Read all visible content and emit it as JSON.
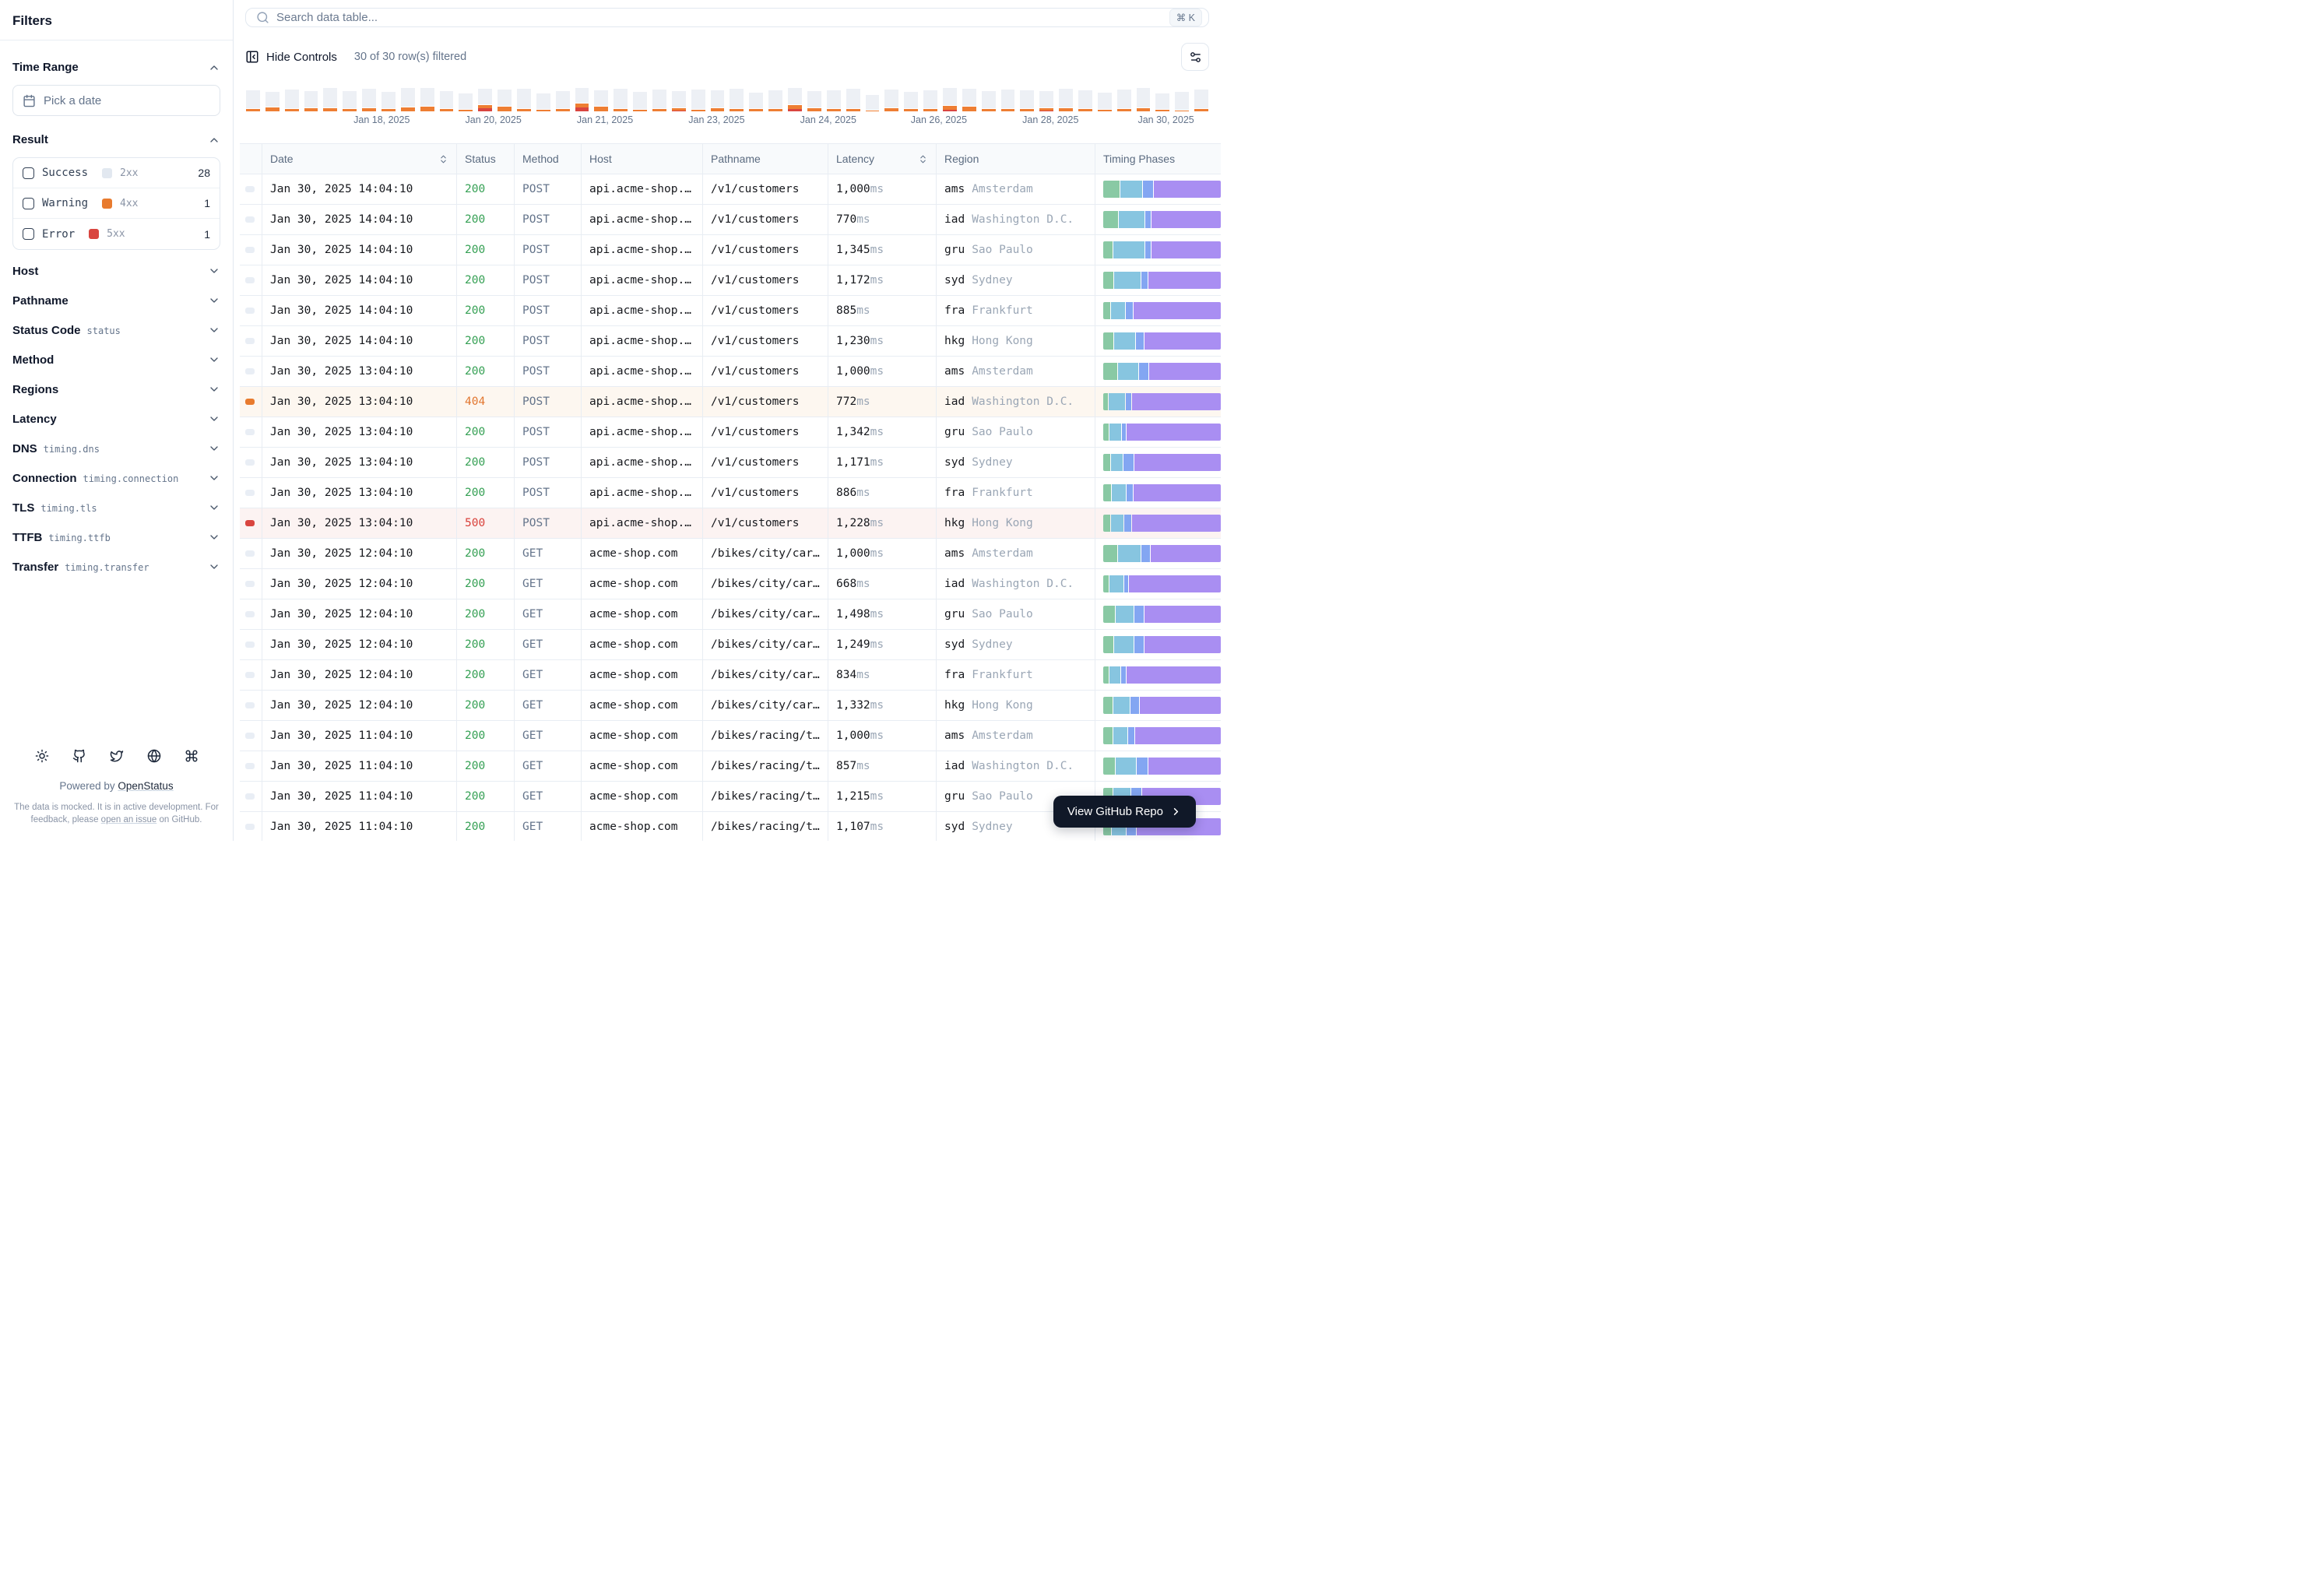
{
  "sidebar": {
    "title": "Filters",
    "time_range": {
      "label": "Time Range",
      "placeholder": "Pick a date"
    },
    "result": {
      "label": "Result",
      "items": [
        {
          "label": "Success",
          "code": "2xx",
          "count": "28",
          "swatch": "#e2e8f0"
        },
        {
          "label": "Warning",
          "code": "4xx",
          "count": "1",
          "swatch": "#e87b2e"
        },
        {
          "label": "Error",
          "code": "5xx",
          "count": "1",
          "swatch": "#d9453f"
        }
      ]
    },
    "sections": [
      {
        "label": "Host"
      },
      {
        "label": "Pathname"
      },
      {
        "label": "Status Code",
        "code": "status"
      },
      {
        "label": "Method"
      },
      {
        "label": "Regions"
      },
      {
        "label": "Latency"
      },
      {
        "label": "DNS",
        "code": "timing.dns"
      },
      {
        "label": "Connection",
        "code": "timing.connection"
      },
      {
        "label": "TLS",
        "code": "timing.tls"
      },
      {
        "label": "TTFB",
        "code": "timing.ttfb"
      },
      {
        "label": "Transfer",
        "code": "timing.transfer"
      }
    ],
    "footer": {
      "icons": [
        "sun-icon",
        "github-icon",
        "twitter-icon",
        "globe-icon",
        "command-icon"
      ],
      "powered_prefix": "Powered by ",
      "brand": "OpenStatus",
      "note_pre": "The data is mocked. It is in active development. For feedback, please ",
      "note_link": "open an issue",
      "note_post": " on GitHub."
    }
  },
  "topbar": {
    "search_placeholder": "Search data table...",
    "shortcut": "⌘ K"
  },
  "controls": {
    "hide_label": "Hide Controls",
    "filtered_text": "30 of 30 row(s) filtered"
  },
  "chart_data": {
    "type": "bar",
    "stacked": true,
    "x_labels": [
      "Jan 18, 2025",
      "Jan 20, 2025",
      "Jan 21, 2025",
      "Jan 23, 2025",
      "Jan 24, 2025",
      "Jan 26, 2025",
      "Jan 28, 2025",
      "Jan 30, 2025"
    ],
    "label_positions_pct": [
      14.1,
      25.7,
      37.3,
      48.9,
      60.5,
      72.0,
      83.6,
      95.6
    ],
    "ylabel": "",
    "xlabel": "",
    "legend": "none",
    "series": [
      {
        "name": "success-2xx",
        "color": "#edf0f5",
        "values": [
          23,
          19,
          24,
          21,
          25,
          22,
          24,
          21,
          24,
          23,
          22,
          20,
          20,
          21,
          25,
          20,
          22,
          19,
          20,
          25,
          22,
          24,
          21,
          25,
          22,
          25,
          20,
          23,
          21,
          21,
          23,
          25,
          19,
          23,
          21,
          23,
          22,
          22,
          22,
          24,
          23,
          21,
          24,
          23,
          21,
          24,
          25,
          20,
          23,
          24
        ]
      },
      {
        "name": "warning-4xx",
        "color": "#ee7e33",
        "values": [
          3,
          5,
          3,
          4,
          4,
          3,
          4,
          3,
          5,
          6,
          3,
          2,
          4,
          6,
          3,
          2,
          3,
          5,
          6,
          3,
          2,
          3,
          3,
          2,
          4,
          3,
          3,
          3,
          5,
          4,
          3,
          3,
          1,
          4,
          3,
          3,
          5,
          6,
          3,
          3,
          3,
          3,
          4,
          3,
          2,
          3,
          4,
          2,
          1,
          3
        ]
      },
      {
        "name": "error-5xx",
        "color": "#d9453f",
        "values": [
          0,
          0,
          0,
          0,
          0,
          0,
          0,
          0,
          0,
          0,
          0,
          0,
          4,
          0,
          0,
          0,
          0,
          5,
          0,
          0,
          0,
          0,
          1,
          0,
          0,
          0,
          0,
          0,
          3,
          0,
          0,
          0,
          0,
          0,
          0,
          0,
          2,
          0,
          0,
          0,
          0,
          1,
          0,
          0,
          0,
          0,
          0,
          0,
          0,
          0
        ]
      }
    ]
  },
  "table": {
    "timing_colors": [
      "#89c9a4",
      "#87c5e0",
      "#83a6f2",
      "#a98ef2"
    ],
    "columns": [
      {
        "label": "Date",
        "sortable": true
      },
      {
        "label": "Status",
        "sortable": false
      },
      {
        "label": "Method",
        "sortable": false
      },
      {
        "label": "Host",
        "sortable": false
      },
      {
        "label": "Pathname",
        "sortable": false
      },
      {
        "label": "Latency",
        "sortable": true
      },
      {
        "label": "Region",
        "sortable": false
      },
      {
        "label": "Timing Phases",
        "sortable": false
      }
    ],
    "rows": [
      {
        "date": "Jan 30, 2025 14:04:10",
        "status": "200",
        "level": "success",
        "method": "POST",
        "host": "api.acme-shop.…",
        "path": "/v1/customers",
        "latency": "1,000",
        "unit": "ms",
        "region": "ams",
        "city": "Amsterdam",
        "timing": [
          14,
          19,
          9,
          58
        ]
      },
      {
        "date": "Jan 30, 2025 14:04:10",
        "status": "200",
        "level": "success",
        "method": "POST",
        "host": "api.acme-shop.…",
        "path": "/v1/customers",
        "latency": "770",
        "unit": "ms",
        "region": "iad",
        "city": "Washington D.C.",
        "timing": [
          13,
          22,
          5,
          60
        ]
      },
      {
        "date": "Jan 30, 2025 14:04:10",
        "status": "200",
        "level": "success",
        "method": "POST",
        "host": "api.acme-shop.…",
        "path": "/v1/customers",
        "latency": "1,345",
        "unit": "ms",
        "region": "gru",
        "city": "Sao Paulo",
        "timing": [
          8,
          27,
          5,
          60
        ]
      },
      {
        "date": "Jan 30, 2025 14:04:10",
        "status": "200",
        "level": "success",
        "method": "POST",
        "host": "api.acme-shop.…",
        "path": "/v1/customers",
        "latency": "1,172",
        "unit": "ms",
        "region": "syd",
        "city": "Sydney",
        "timing": [
          9,
          23,
          5,
          63
        ]
      },
      {
        "date": "Jan 30, 2025 14:04:10",
        "status": "200",
        "level": "success",
        "method": "POST",
        "host": "api.acme-shop.…",
        "path": "/v1/customers",
        "latency": "885",
        "unit": "ms",
        "region": "fra",
        "city": "Frankfurt",
        "timing": [
          6,
          12,
          6,
          76
        ]
      },
      {
        "date": "Jan 30, 2025 14:04:10",
        "status": "200",
        "level": "success",
        "method": "POST",
        "host": "api.acme-shop.…",
        "path": "/v1/customers",
        "latency": "1,230",
        "unit": "ms",
        "region": "hkg",
        "city": "Hong Kong",
        "timing": [
          9,
          18,
          7,
          66
        ]
      },
      {
        "date": "Jan 30, 2025 13:04:10",
        "status": "200",
        "level": "success",
        "method": "POST",
        "host": "api.acme-shop.…",
        "path": "/v1/customers",
        "latency": "1,000",
        "unit": "ms",
        "region": "ams",
        "city": "Amsterdam",
        "timing": [
          12,
          18,
          8,
          62
        ]
      },
      {
        "date": "Jan 30, 2025 13:04:10",
        "status": "404",
        "level": "warning",
        "method": "POST",
        "host": "api.acme-shop.…",
        "path": "/v1/customers",
        "latency": "772",
        "unit": "ms",
        "region": "iad",
        "city": "Washington D.C.",
        "timing": [
          4,
          14,
          5,
          77
        ]
      },
      {
        "date": "Jan 30, 2025 13:04:10",
        "status": "200",
        "level": "success",
        "method": "POST",
        "host": "api.acme-shop.…",
        "path": "/v1/customers",
        "latency": "1,342",
        "unit": "ms",
        "region": "gru",
        "city": "Sao Paulo",
        "timing": [
          5,
          10,
          3,
          82
        ]
      },
      {
        "date": "Jan 30, 2025 13:04:10",
        "status": "200",
        "level": "success",
        "method": "POST",
        "host": "api.acme-shop.…",
        "path": "/v1/customers",
        "latency": "1,171",
        "unit": "ms",
        "region": "syd",
        "city": "Sydney",
        "timing": [
          6,
          10,
          9,
          75
        ]
      },
      {
        "date": "Jan 30, 2025 13:04:10",
        "status": "200",
        "level": "success",
        "method": "POST",
        "host": "api.acme-shop.…",
        "path": "/v1/customers",
        "latency": "886",
        "unit": "ms",
        "region": "fra",
        "city": "Frankfurt",
        "timing": [
          7,
          12,
          5,
          76
        ]
      },
      {
        "date": "Jan 30, 2025 13:04:10",
        "status": "500",
        "level": "error",
        "method": "POST",
        "host": "api.acme-shop.…",
        "path": "/v1/customers",
        "latency": "1,228",
        "unit": "ms",
        "region": "hkg",
        "city": "Hong Kong",
        "timing": [
          6,
          11,
          6,
          77
        ]
      },
      {
        "date": "Jan 30, 2025 12:04:10",
        "status": "200",
        "level": "success",
        "method": "GET",
        "host": "acme-shop.com",
        "path": "/bikes/city/car…",
        "latency": "1,000",
        "unit": "ms",
        "region": "ams",
        "city": "Amsterdam",
        "timing": [
          12,
          20,
          7,
          61
        ]
      },
      {
        "date": "Jan 30, 2025 12:04:10",
        "status": "200",
        "level": "success",
        "method": "GET",
        "host": "acme-shop.com",
        "path": "/bikes/city/car…",
        "latency": "668",
        "unit": "ms",
        "region": "iad",
        "city": "Washington D.C.",
        "timing": [
          5,
          12,
          3,
          80
        ]
      },
      {
        "date": "Jan 30, 2025 12:04:10",
        "status": "200",
        "level": "success",
        "method": "GET",
        "host": "acme-shop.com",
        "path": "/bikes/city/car…",
        "latency": "1,498",
        "unit": "ms",
        "region": "gru",
        "city": "Sao Paulo",
        "timing": [
          10,
          16,
          8,
          66
        ]
      },
      {
        "date": "Jan 30, 2025 12:04:10",
        "status": "200",
        "level": "success",
        "method": "GET",
        "host": "acme-shop.com",
        "path": "/bikes/city/car…",
        "latency": "1,249",
        "unit": "ms",
        "region": "syd",
        "city": "Sydney",
        "timing": [
          9,
          17,
          8,
          66
        ]
      },
      {
        "date": "Jan 30, 2025 12:04:10",
        "status": "200",
        "level": "success",
        "method": "GET",
        "host": "acme-shop.com",
        "path": "/bikes/city/car…",
        "latency": "834",
        "unit": "ms",
        "region": "fra",
        "city": "Frankfurt",
        "timing": [
          5,
          9,
          4,
          82
        ]
      },
      {
        "date": "Jan 30, 2025 12:04:10",
        "status": "200",
        "level": "success",
        "method": "GET",
        "host": "acme-shop.com",
        "path": "/bikes/city/car…",
        "latency": "1,332",
        "unit": "ms",
        "region": "hkg",
        "city": "Hong Kong",
        "timing": [
          8,
          14,
          8,
          70
        ]
      },
      {
        "date": "Jan 30, 2025 11:04:10",
        "status": "200",
        "level": "success",
        "method": "GET",
        "host": "acme-shop.com",
        "path": "/bikes/racing/t…",
        "latency": "1,000",
        "unit": "ms",
        "region": "ams",
        "city": "Amsterdam",
        "timing": [
          8,
          12,
          6,
          74
        ]
      },
      {
        "date": "Jan 30, 2025 11:04:10",
        "status": "200",
        "level": "success",
        "method": "GET",
        "host": "acme-shop.com",
        "path": "/bikes/racing/t…",
        "latency": "857",
        "unit": "ms",
        "region": "iad",
        "city": "Washington D.C.",
        "timing": [
          10,
          18,
          9,
          63
        ]
      },
      {
        "date": "Jan 30, 2025 11:04:10",
        "status": "200",
        "level": "success",
        "method": "GET",
        "host": "acme-shop.com",
        "path": "/bikes/racing/t…",
        "latency": "1,215",
        "unit": "ms",
        "region": "gru",
        "city": "Sao Paulo",
        "timing": [
          8,
          15,
          9,
          68
        ]
      },
      {
        "date": "Jan 30, 2025 11:04:10",
        "status": "200",
        "level": "success",
        "method": "GET",
        "host": "acme-shop.com",
        "path": "/bikes/racing/t…",
        "latency": "1,107",
        "unit": "ms",
        "region": "syd",
        "city": "Sydney",
        "timing": [
          7,
          12,
          8,
          73
        ]
      }
    ]
  },
  "github_button": {
    "label": "View GitHub Repo"
  }
}
